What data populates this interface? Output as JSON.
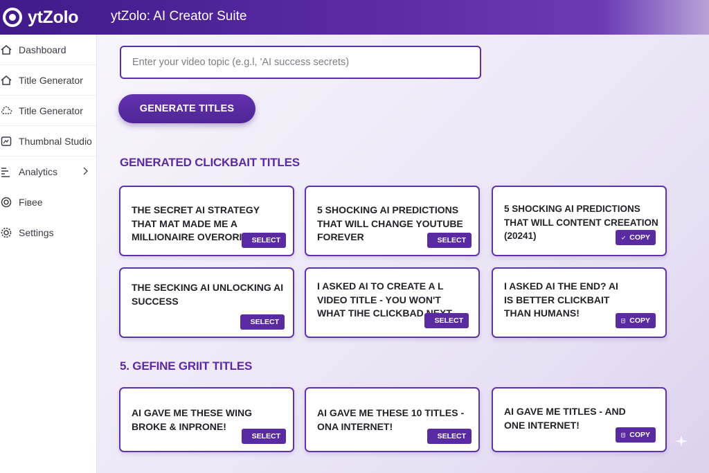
{
  "header": {
    "logo_text": "ytZolo",
    "app_title": "ytZolo: AI Creator Suite"
  },
  "sidebar": {
    "items": [
      {
        "label": "Dashboard",
        "icon": "home-icon"
      },
      {
        "label": "Title Generator",
        "icon": "home-icon"
      },
      {
        "label": "Title Generator",
        "icon": "cloud-icon"
      },
      {
        "label": "Thumbnal Studio",
        "icon": "image-icon"
      },
      {
        "label": "Analytics",
        "icon": "analytics-icon",
        "has_chevron": true
      },
      {
        "label": "Fiвее",
        "icon": "target-icon"
      },
      {
        "label": "Settings",
        "icon": "gear-icon"
      }
    ]
  },
  "topic_input": {
    "value": "",
    "placeholder": "Enter your video topic (e.g.l, 'AI success secrets)"
  },
  "generate_button": {
    "label": "GENERATE TITLES"
  },
  "sections": [
    {
      "title": "GENERATED CLICKBAIT TITLES",
      "cards": [
        {
          "text": "THE SECRET AI STRATEGY THAT MAT MADE ME A MILLIONAIRE OVERORIGHT",
          "button": "SELECT",
          "button_icon": "clipboard-icon"
        },
        {
          "text": "5 SHOCKING AI PREDICTIONS THAT WILL CHANGE YOUTUBE FOREVER",
          "button": "SELECT",
          "button_icon": "clipboard-icon"
        },
        {
          "text": "5 SHOCKING AI PREDICTIONS THAT WILL CONTENT CREEATION (20241)",
          "button": "COPY",
          "button_icon": "check-icon"
        },
        {
          "text": "THE SECKING AI UNLOCKING AI SUCCESS",
          "button": "SELECT",
          "button_icon": "clipboard-icon"
        },
        {
          "text": "I ASKED AI TO CREATE A L VIDEO TITLE - YOU WON'T WHAT TIHE CLICKBAD NEXT",
          "button": "SELECT",
          "button_icon": "clipboard-icon"
        },
        {
          "text": "I ASKED AI THE END? AI IS BETTER CLICKBAIT THAN HUMANS!",
          "button": "COPY",
          "button_icon": "clipboard-icon"
        }
      ]
    },
    {
      "title": "5. GEFINE GRIIT TITLES",
      "cards": [
        {
          "text": "AI GAVE ME THESE WING BROKE & INPRONE!",
          "button": "SELECT",
          "button_icon": "clipboard-icon"
        },
        {
          "text": "AI GAVE ME THESE 10 TITLES - ONA INTERNET!",
          "button": "SELECT",
          "button_icon": "clipboard-icon"
        },
        {
          "text": "AI GAVE ME TITLES - AND ONE INTERNET!",
          "button": "COPY",
          "button_icon": "clipboard-icon"
        }
      ]
    }
  ],
  "colors": {
    "brand": "#5a2aa3",
    "header_start": "#3f1a8a",
    "card_border": "#5d33a8"
  }
}
